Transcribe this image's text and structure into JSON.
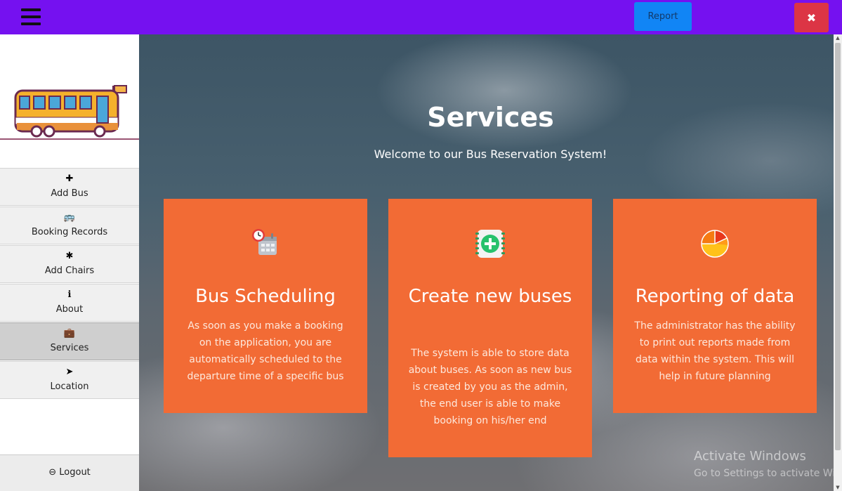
{
  "topbar": {
    "report_label": "Report",
    "close_label": "✖"
  },
  "sidebar": {
    "items": [
      {
        "label": "Add Bus",
        "icon": "✚"
      },
      {
        "label": "Booking Records",
        "icon": "🚌"
      },
      {
        "label": "Add Chairs",
        "icon": "✱"
      },
      {
        "label": "About",
        "icon": "ℹ"
      },
      {
        "label": "Services",
        "icon": "💼"
      },
      {
        "label": "Location",
        "icon": "➤"
      }
    ],
    "logout_label": "Logout",
    "logout_icon": "⊖"
  },
  "main": {
    "title": "Services",
    "subtitle": "Welcome to our Bus Reservation System!",
    "cards": [
      {
        "title": "Bus Scheduling",
        "text": "As soon as you make a booking on the application, you are automatically scheduled to the departure time of a specific bus",
        "icon": "calendar-clock-icon"
      },
      {
        "title": "Create new buses",
        "text": "The system is able to store data about buses. As soon as new bus is created by you as the admin, the end user is able to make booking on his/her end",
        "icon": "add-bus-icon"
      },
      {
        "title": "Reporting of data",
        "text": "The administrator has the ability to print out reports made from data within the system. This will help in future planning",
        "icon": "pie-chart-icon"
      }
    ]
  },
  "watermark": {
    "line1": "Activate Windows",
    "line2": "Go to Settings to activate Windows."
  },
  "colors": {
    "topbar": "#7511f0",
    "report_button": "#1185f5",
    "close_button": "#dc3545",
    "card": "#f26b35"
  }
}
